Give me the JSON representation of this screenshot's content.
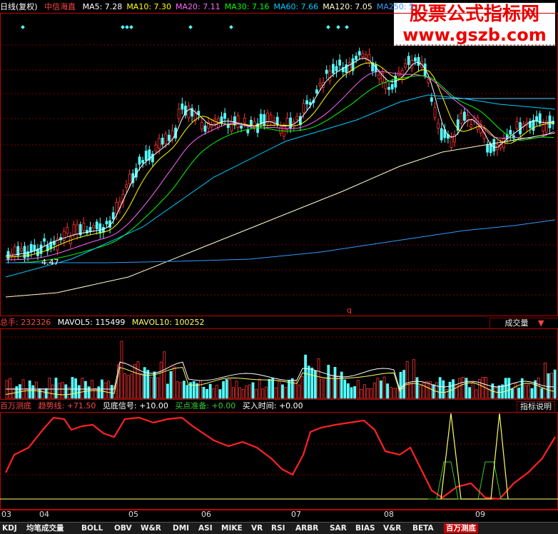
{
  "chart": {
    "period_label": "日线(复权)",
    "indicator_name": "中信海直",
    "ma": [
      {
        "label": "MA5: 7.28",
        "color": "#ffffff"
      },
      {
        "label": "MA10: 7.30",
        "color": "#ffff00"
      },
      {
        "label": "MA20: 7.11",
        "color": "#ff66ff"
      },
      {
        "label": "MA30: 7.16",
        "color": "#00ff00"
      },
      {
        "label": "MA60: 7.66",
        "color": "#00ccff"
      },
      {
        "label": "MA120: 7.05",
        "color": "#ffffcc"
      },
      {
        "label": "MA250: 5",
        "color": "#3399ff"
      }
    ],
    "low_marker": "4.47",
    "q_marker": "q"
  },
  "volume": {
    "label": "总手: 232326",
    "mavol5": "MAVOL5: 115499",
    "mavol10": "MAVOL10: 100252",
    "selector": "成交量"
  },
  "indicator": {
    "name": "百万测底",
    "trend": "趋势线: +71.50",
    "see_bottom": "见底信号: +10.00",
    "buy_ready": "买点准备: +0.00",
    "buy_time": "买入时间: +0.00",
    "help_button": "指标说明"
  },
  "x_axis": [
    "03",
    "04",
    "05",
    "06",
    "07",
    "08",
    "09"
  ],
  "tabs": [
    "KDJ",
    "均笔成交量",
    "BOLL",
    "OBV",
    "W&R",
    "DMI",
    "ASI",
    "MIKE",
    "VR",
    "RSI",
    "ARBR",
    "SAR",
    "BIAS",
    "V&R",
    "BETA",
    "百万测底"
  ],
  "watermark": {
    "line1": "股票公式指标网",
    "line2": "www.gszb.com"
  },
  "colors": {
    "up": "#ff3333",
    "down": "#54ffff",
    "grid": "#800000",
    "border": "#c00000"
  }
}
